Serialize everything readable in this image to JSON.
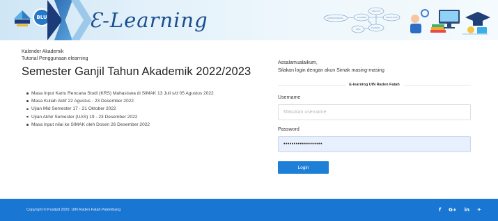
{
  "header": {
    "logo_blu_text": "BLU",
    "brand_title": "Ɛ-Learning",
    "deco_nodes": [
      "PRACTICE",
      "KNOWLEDGE",
      "LEARNING",
      "SKILL",
      "TRAINING",
      "UNDERSTANDING"
    ]
  },
  "links": {
    "academic_calendar": "Kalender Akademik",
    "usage_tutorial": "Tutorial Penggunaan elearning"
  },
  "main": {
    "title": "Semester Ganjil Tahun Akademik 2022/2023",
    "announcements": [
      "Masa Input Kartu Rencana Studi (KRS) Mahasiswa di SIMAK 13 Juli s/d 05 Agustus 2022",
      "Masa Kuliah Aktif 22 Agustus - 23 Desember 2022",
      "Ujian Mid Semester 17 - 21 Oktober 2022",
      "Ujian Akhir Semester (UAS) 19 - 23 Desember 2022",
      "Masa input nilai ke SIMAK oleh Dosen 26 Desember 2022"
    ]
  },
  "login": {
    "greeting_line1": "Assalamualaikum,",
    "greeting_line2": "Silakan login dengan akun Simak masing-masing",
    "section_label": "E-learning UIN Raden Fatah",
    "username_label": "Username",
    "username_placeholder": "Masukan username",
    "username_value": "",
    "password_label": "Password",
    "password_value": "•••••••••••••••••••",
    "button_label": "Login"
  },
  "footer": {
    "copyright": "Copyright © Pustipd 2020. UIN Raden Fatah Palembang",
    "social_icons": [
      {
        "name": "facebook-icon",
        "glyph": "f"
      },
      {
        "name": "google-plus-icon",
        "glyph": "G+"
      },
      {
        "name": "linkedin-icon",
        "glyph": "in"
      },
      {
        "name": "twitter-icon",
        "glyph": "✈"
      }
    ]
  },
  "colors": {
    "primary": "#1976d2",
    "button": "#1e7fd6",
    "brand_text": "#1a4e8f",
    "password_field_bg": "#e8effd"
  }
}
